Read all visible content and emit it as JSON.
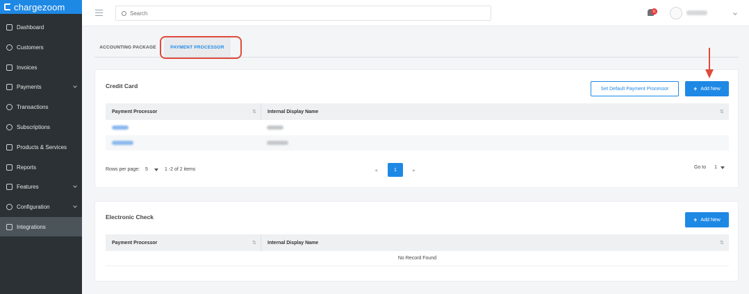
{
  "app": {
    "name": "chargezoom"
  },
  "sidebar": {
    "items": [
      {
        "label": "Dashboard"
      },
      {
        "label": "Customers"
      },
      {
        "label": "Invoices"
      },
      {
        "label": "Payments"
      },
      {
        "label": "Transactions"
      },
      {
        "label": "Subscriptions"
      },
      {
        "label": "Products & Services"
      },
      {
        "label": "Reports"
      },
      {
        "label": "Features"
      },
      {
        "label": "Configuration"
      },
      {
        "label": "Integrations"
      }
    ],
    "active": "Integrations"
  },
  "header": {
    "search_placeholder": "Search",
    "notification_count": "11"
  },
  "tabs": [
    {
      "label": "ACCOUNTING PACKAGE"
    },
    {
      "label": "PAYMENT PROCESSOR"
    }
  ],
  "credit_card": {
    "title": "Credit Card",
    "set_default_label": "Set Default Payment Processor",
    "add_new_label": "Add New",
    "columns": [
      "Payment Processor",
      "Internal Display Name"
    ],
    "sort_glyph": "⇅",
    "rows_per_page_label": "Rows per page:",
    "rows_per_page_value": "5",
    "range_text": "1 -2 of 2  items",
    "current_page": "1",
    "prev_glyph": "◂",
    "next_glyph": "▸",
    "goto_label": "Go to",
    "goto_value": "1"
  },
  "electronic_check": {
    "title": "Electronic Check",
    "add_new_label": "Add New",
    "columns": [
      "Payment Processor",
      "Internal Display Name"
    ],
    "sort_glyph": "⇅",
    "empty_text": "No Record Found"
  },
  "colors": {
    "primary": "#1e88e5",
    "sidebar_bg": "#2b3134",
    "annotation": "#e04a3a"
  }
}
